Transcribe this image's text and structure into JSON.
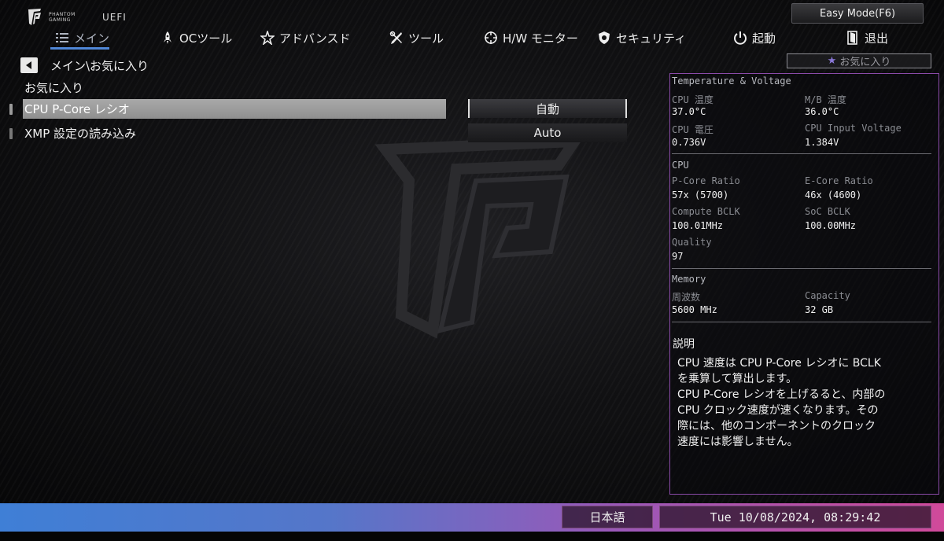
{
  "brand": {
    "logo_line1": "PHANTOM",
    "logo_line2": "GAMING",
    "uefi": "UEFI"
  },
  "easy_mode": "Easy Mode(F6)",
  "nav": {
    "items": [
      {
        "label": "メイン",
        "icon": "list-icon"
      },
      {
        "label": "OCツール",
        "icon": "rocket-icon"
      },
      {
        "label": "アドバンスド",
        "icon": "star-icon"
      },
      {
        "label": "ツール",
        "icon": "tools-icon"
      },
      {
        "label": "H/W モニター",
        "icon": "crosshair-icon"
      },
      {
        "label": "セキュリティ",
        "icon": "shield-icon"
      },
      {
        "label": "起動",
        "icon": "power-icon"
      },
      {
        "label": "退出",
        "icon": "exit-icon"
      }
    ]
  },
  "breadcrumb": "メイン\\お気に入り",
  "section_title": "お気に入り",
  "settings": [
    {
      "label": "CPU P-Core レシオ",
      "value": "自動"
    },
    {
      "label": "XMP 設定の読み込み",
      "value": "Auto"
    }
  ],
  "favorites_button": "お気に入り",
  "monitor": {
    "temp_voltage": {
      "heading": "Temperature & Voltage",
      "cpu_temp_label": "CPU 温度",
      "cpu_temp": "37.0°C",
      "mb_temp_label": "M/B 温度",
      "mb_temp": "36.0°C",
      "cpu_volt_label": "CPU 電圧",
      "cpu_volt": "0.736V",
      "cpu_input_label": "CPU Input Voltage",
      "cpu_input": "1.384V"
    },
    "cpu": {
      "heading": "CPU",
      "pcore_label": "P-Core Ratio",
      "pcore": "57x (5700)",
      "ecore_label": "E-Core Ratio",
      "ecore": "46x (4600)",
      "bclk_label": "Compute BCLK",
      "bclk": "100.01MHz",
      "soc_label": "SoC BCLK",
      "soc": "100.00MHz",
      "quality_label": "Quality",
      "quality": "97"
    },
    "memory": {
      "heading": "Memory",
      "freq_label": "周波数",
      "freq": "5600 MHz",
      "cap_label": "Capacity",
      "cap": "32 GB"
    }
  },
  "description": {
    "title": "説明",
    "text": "CPU 速度は CPU P-Core レシオに BCLK\nを乗算して算出します。\nCPU P-Core レシオを上げるると、内部の\nCPU クロック速度が速くなります。その\n際には、他のコンポーネントのクロック\n速度には影響しません。"
  },
  "footer": {
    "language": "日本語",
    "datetime": "Tue 10/08/2024, 08:29:42"
  },
  "colors": {
    "accent": "#4f86d6",
    "panel_border": "#8a4aa8",
    "bar_left": "#3f7fd6",
    "bar_right": "#d04a9a"
  }
}
